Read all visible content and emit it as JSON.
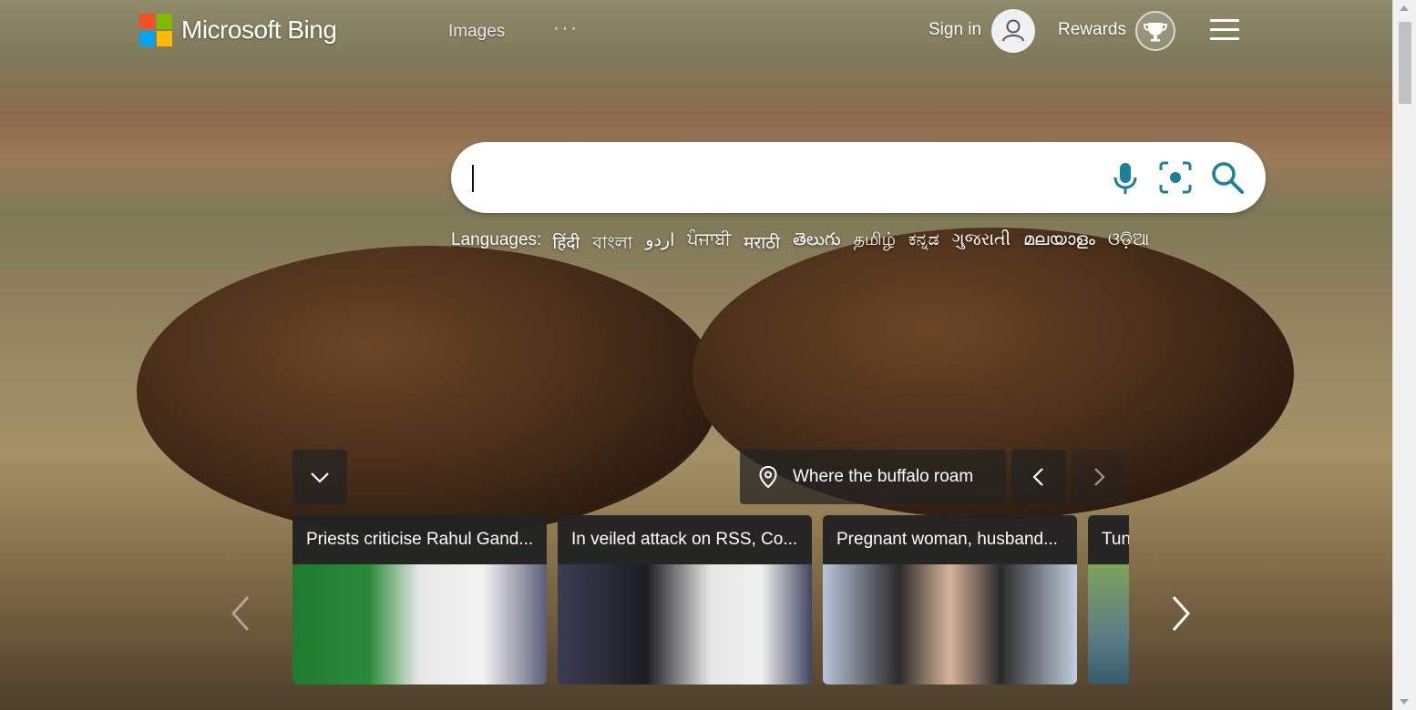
{
  "header": {
    "logo_text": "Microsoft Bing",
    "nav_images": "Images",
    "nav_more": "···",
    "signin": "Sign in",
    "rewards": "Rewards"
  },
  "search": {
    "placeholder": "",
    "value": ""
  },
  "languages": {
    "label": "Languages:",
    "items": [
      "हिंदी",
      "বাংলা",
      "اردو",
      "ਪੰਜਾਬੀ",
      "मराठी",
      "తెలుగు",
      "தமிழ்",
      "ಕನ್ನಡ",
      "ગુજરાતી",
      "മലയാളം",
      "ଓଡ଼ିଆ"
    ]
  },
  "image_of_day": {
    "location": "Where the buffalo roam"
  },
  "news": [
    {
      "title": "Priests criticise Rahul Gand..."
    },
    {
      "title": "In veiled attack on RSS, Co..."
    },
    {
      "title": "Pregnant woman, husband..."
    },
    {
      "title": "Tun"
    }
  ],
  "colors": {
    "accent": "#1a7f9b",
    "ms_red": "#f25022",
    "ms_green": "#7fba00",
    "ms_blue": "#00a4ef",
    "ms_yellow": "#ffb900"
  }
}
